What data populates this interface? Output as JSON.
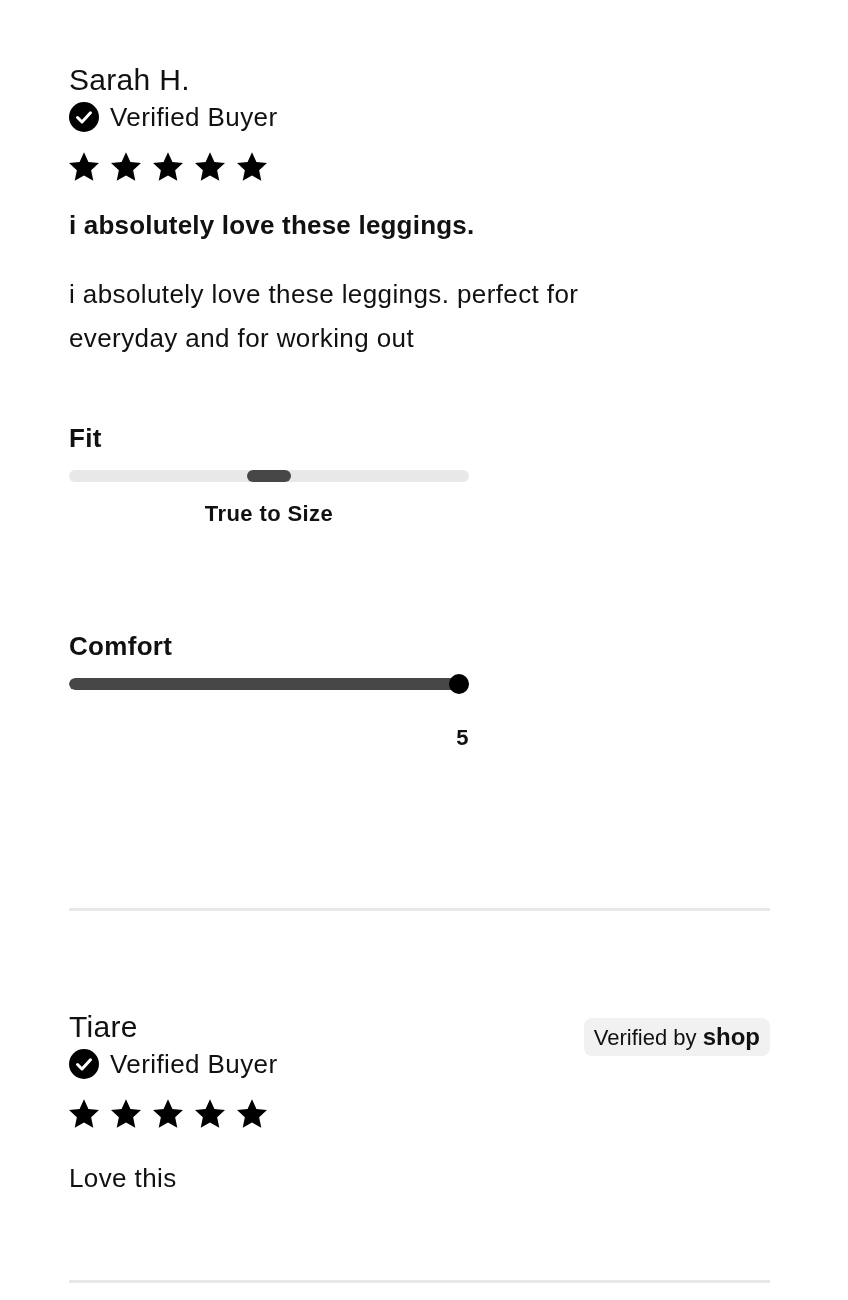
{
  "reviews": [
    {
      "author": "Sarah H.",
      "verified_label": "Verified Buyer",
      "stars": 5,
      "title": "i absolutely love these leggings.",
      "body": "i absolutely love these leggings. perfect for everyday and for working out",
      "attributes": [
        {
          "label": "Fit",
          "kind": "position",
          "level": 0.5,
          "value_label": "True to Size"
        },
        {
          "label": "Comfort",
          "kind": "fill",
          "level": 1,
          "value_label": "5"
        }
      ]
    },
    {
      "author": "Tiare",
      "verified_label": "Verified Buyer",
      "shop_badge": "Verified by **shop**",
      "stars": 5,
      "body": "Love this"
    }
  ]
}
